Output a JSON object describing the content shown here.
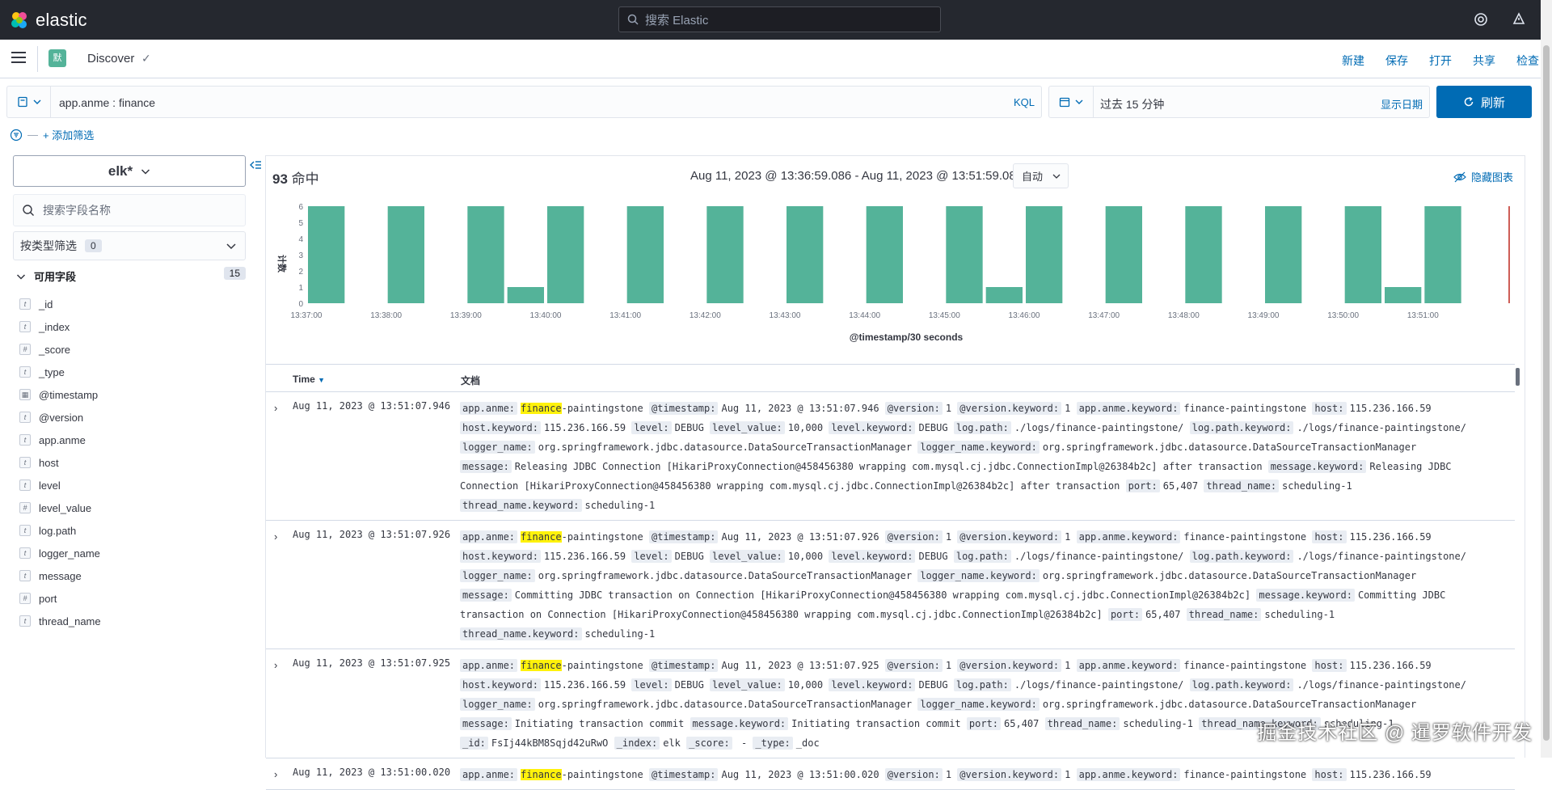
{
  "header": {
    "brand": "elastic",
    "search_placeholder": "搜索 Elastic"
  },
  "appbar": {
    "app_badge": "默",
    "app_name": "Discover",
    "nav": [
      "新建",
      "保存",
      "打开",
      "共享",
      "检查"
    ]
  },
  "query": {
    "text": "app.anme : finance",
    "language": "KQL"
  },
  "date": {
    "range": "过去 15 分钟",
    "show_dates": "显示日期",
    "refresh": "刷新"
  },
  "filters": {
    "add_filter": "+ 添加筛选"
  },
  "sidebar": {
    "index_pattern": "elk*",
    "field_search_placeholder": "搜索字段名称",
    "type_filter_label": "按类型筛选",
    "type_filter_count": "0",
    "available_label": "可用字段",
    "available_count": "15",
    "fields": [
      {
        "type": "t",
        "name": "_id"
      },
      {
        "type": "t",
        "name": "_index"
      },
      {
        "type": "#",
        "name": "_score"
      },
      {
        "type": "t",
        "name": "_type"
      },
      {
        "type": "date",
        "name": "@timestamp"
      },
      {
        "type": "t",
        "name": "@version"
      },
      {
        "type": "t",
        "name": "app.anme"
      },
      {
        "type": "t",
        "name": "host"
      },
      {
        "type": "t",
        "name": "level"
      },
      {
        "type": "#",
        "name": "level_value"
      },
      {
        "type": "t",
        "name": "log.path"
      },
      {
        "type": "t",
        "name": "logger_name"
      },
      {
        "type": "t",
        "name": "message"
      },
      {
        "type": "#",
        "name": "port"
      },
      {
        "type": "t",
        "name": "thread_name"
      }
    ]
  },
  "main": {
    "hits_count": "93",
    "hits_label": "命中",
    "time_range": "Aug 11, 2023 @ 13:36:59.086 - Aug 11, 2023 @ 13:51:59.086",
    "interval": "自动",
    "hide_chart": "隐藏图表",
    "col_time": "Time",
    "col_doc": "文档"
  },
  "chart_data": {
    "type": "bar",
    "xlabel": "@timestamp/30 seconds",
    "ylabel": "计数",
    "ylim": [
      0,
      6
    ],
    "yticks": [
      "0",
      "1",
      "2",
      "3",
      "4",
      "5",
      "6"
    ],
    "x_ticks": [
      "13:37:00",
      "13:38:00",
      "13:39:00",
      "13:40:00",
      "13:41:00",
      "13:42:00",
      "13:43:00",
      "13:44:00",
      "13:45:00",
      "13:46:00",
      "13:47:00",
      "13:48:00",
      "13:49:00",
      "13:50:00",
      "13:51:00"
    ],
    "categories": [
      "13:37:00",
      "13:37:30",
      "13:38:00",
      "13:38:30",
      "13:39:00",
      "13:39:30",
      "13:40:00",
      "13:40:30",
      "13:41:00",
      "13:41:30",
      "13:42:00",
      "13:42:30",
      "13:43:00",
      "13:43:30",
      "13:44:00",
      "13:44:30",
      "13:45:00",
      "13:45:30",
      "13:46:00",
      "13:46:30",
      "13:47:00",
      "13:47:30",
      "13:48:00",
      "13:48:30",
      "13:49:00",
      "13:49:30",
      "13:50:00",
      "13:50:30",
      "13:51:00",
      "13:51:30"
    ],
    "values": [
      6,
      0,
      6,
      0,
      6,
      1,
      6,
      0,
      6,
      0,
      6,
      0,
      6,
      0,
      6,
      0,
      6,
      1,
      6,
      0,
      6,
      0,
      6,
      0,
      6,
      0,
      6,
      1,
      6,
      0
    ],
    "bar_color": "#54b399",
    "marker_color": "#bd271e"
  },
  "rows": [
    {
      "time": "Aug 11, 2023 @ 13:51:07.946",
      "fields": [
        {
          "k": "app.anme:",
          "v": "finance",
          "v2": "-paintingstone",
          "hl": true
        },
        {
          "k": "@timestamp:",
          "v": "Aug 11, 2023 @ 13:51:07.946"
        },
        {
          "k": "@version:",
          "v": "1"
        },
        {
          "k": "@version.keyword:",
          "v": "1"
        },
        {
          "k": "app.anme.keyword:",
          "v": "finance-paintingstone"
        },
        {
          "k": "host:",
          "v": "115.236.166.59"
        },
        {
          "k": "host.keyword:",
          "v": "115.236.166.59"
        },
        {
          "k": "level:",
          "v": "DEBUG"
        },
        {
          "k": "level_value:",
          "v": "10,000"
        },
        {
          "k": "level.keyword:",
          "v": "DEBUG"
        },
        {
          "k": "log.path:",
          "v": "./logs/finance-paintingstone/"
        },
        {
          "k": "log.path.keyword:",
          "v": "./logs/finance-paintingstone/"
        },
        {
          "k": "logger_name:",
          "v": "org.springframework.jdbc.datasource.DataSourceTransactionManager"
        },
        {
          "k": "logger_name.keyword:",
          "v": "org.springframework.jdbc.datasource.DataSourceTransactionManager"
        },
        {
          "k": "message:",
          "v": "Releasing JDBC Connection [HikariProxyConnection@458456380 wrapping com.mysql.cj.jdbc.ConnectionImpl@26384b2c] after transaction"
        },
        {
          "k": "message.keyword:",
          "v": "Releasing JDBC Connection [HikariProxyConnection@458456380 wrapping com.mysql.cj.jdbc.ConnectionImpl@26384b2c] after transaction"
        },
        {
          "k": "port:",
          "v": "65,407"
        },
        {
          "k": "thread_name:",
          "v": "scheduling-1"
        },
        {
          "k": "thread_name.keyword:",
          "v": "scheduling-1"
        }
      ]
    },
    {
      "time": "Aug 11, 2023 @ 13:51:07.926",
      "fields": [
        {
          "k": "app.anme:",
          "v": "finance",
          "v2": "-paintingstone",
          "hl": true
        },
        {
          "k": "@timestamp:",
          "v": "Aug 11, 2023 @ 13:51:07.926"
        },
        {
          "k": "@version:",
          "v": "1"
        },
        {
          "k": "@version.keyword:",
          "v": "1"
        },
        {
          "k": "app.anme.keyword:",
          "v": "finance-paintingstone"
        },
        {
          "k": "host:",
          "v": "115.236.166.59"
        },
        {
          "k": "host.keyword:",
          "v": "115.236.166.59"
        },
        {
          "k": "level:",
          "v": "DEBUG"
        },
        {
          "k": "level_value:",
          "v": "10,000"
        },
        {
          "k": "level.keyword:",
          "v": "DEBUG"
        },
        {
          "k": "log.path:",
          "v": "./logs/finance-paintingstone/"
        },
        {
          "k": "log.path.keyword:",
          "v": "./logs/finance-paintingstone/"
        },
        {
          "k": "logger_name:",
          "v": "org.springframework.jdbc.datasource.DataSourceTransactionManager"
        },
        {
          "k": "logger_name.keyword:",
          "v": "org.springframework.jdbc.datasource.DataSourceTransactionManager"
        },
        {
          "k": "message:",
          "v": "Committing JDBC transaction on Connection [HikariProxyConnection@458456380 wrapping com.mysql.cj.jdbc.ConnectionImpl@26384b2c]"
        },
        {
          "k": "message.keyword:",
          "v": "Committing JDBC transaction on Connection [HikariProxyConnection@458456380 wrapping com.mysql.cj.jdbc.ConnectionImpl@26384b2c]"
        },
        {
          "k": "port:",
          "v": "65,407"
        },
        {
          "k": "thread_name:",
          "v": "scheduling-1"
        },
        {
          "k": "thread_name.keyword:",
          "v": "scheduling-1"
        }
      ]
    },
    {
      "time": "Aug 11, 2023 @ 13:51:07.925",
      "fields": [
        {
          "k": "app.anme:",
          "v": "finance",
          "v2": "-paintingstone",
          "hl": true
        },
        {
          "k": "@timestamp:",
          "v": "Aug 11, 2023 @ 13:51:07.925"
        },
        {
          "k": "@version:",
          "v": "1"
        },
        {
          "k": "@version.keyword:",
          "v": "1"
        },
        {
          "k": "app.anme.keyword:",
          "v": "finance-paintingstone"
        },
        {
          "k": "host:",
          "v": "115.236.166.59"
        },
        {
          "k": "host.keyword:",
          "v": "115.236.166.59"
        },
        {
          "k": "level:",
          "v": "DEBUG"
        },
        {
          "k": "level_value:",
          "v": "10,000"
        },
        {
          "k": "level.keyword:",
          "v": "DEBUG"
        },
        {
          "k": "log.path:",
          "v": "./logs/finance-paintingstone/"
        },
        {
          "k": "log.path.keyword:",
          "v": "./logs/finance-paintingstone/"
        },
        {
          "k": "logger_name:",
          "v": "org.springframework.jdbc.datasource.DataSourceTransactionManager"
        },
        {
          "k": "logger_name.keyword:",
          "v": "org.springframework.jdbc.datasource.DataSourceTransactionManager"
        },
        {
          "k": "message:",
          "v": "Initiating transaction commit"
        },
        {
          "k": "message.keyword:",
          "v": "Initiating transaction commit"
        },
        {
          "k": "port:",
          "v": "65,407"
        },
        {
          "k": "thread_name:",
          "v": "scheduling-1"
        },
        {
          "k": "thread_name.keyword:",
          "v": "scheduling-1"
        },
        {
          "k": "_id:",
          "v": "FsIj44kBM8Sqjd42uRwO"
        },
        {
          "k": "_index:",
          "v": "elk"
        },
        {
          "k": "_score:",
          "v": " - "
        },
        {
          "k": "_type:",
          "v": "_doc"
        }
      ]
    },
    {
      "time": "Aug 11, 2023 @ 13:51:00.020",
      "fields": [
        {
          "k": "app.anme:",
          "v": "finance",
          "v2": "-paintingstone",
          "hl": true
        },
        {
          "k": "@timestamp:",
          "v": "Aug 11, 2023 @ 13:51:00.020"
        },
        {
          "k": "@version:",
          "v": "1"
        },
        {
          "k": "@version.keyword:",
          "v": "1"
        },
        {
          "k": "app.anme.keyword:",
          "v": "finance-paintingstone"
        },
        {
          "k": "host:",
          "v": "115.236.166.59"
        }
      ]
    }
  ],
  "watermark": "掘金技术社区 @ 暹罗软件开发"
}
